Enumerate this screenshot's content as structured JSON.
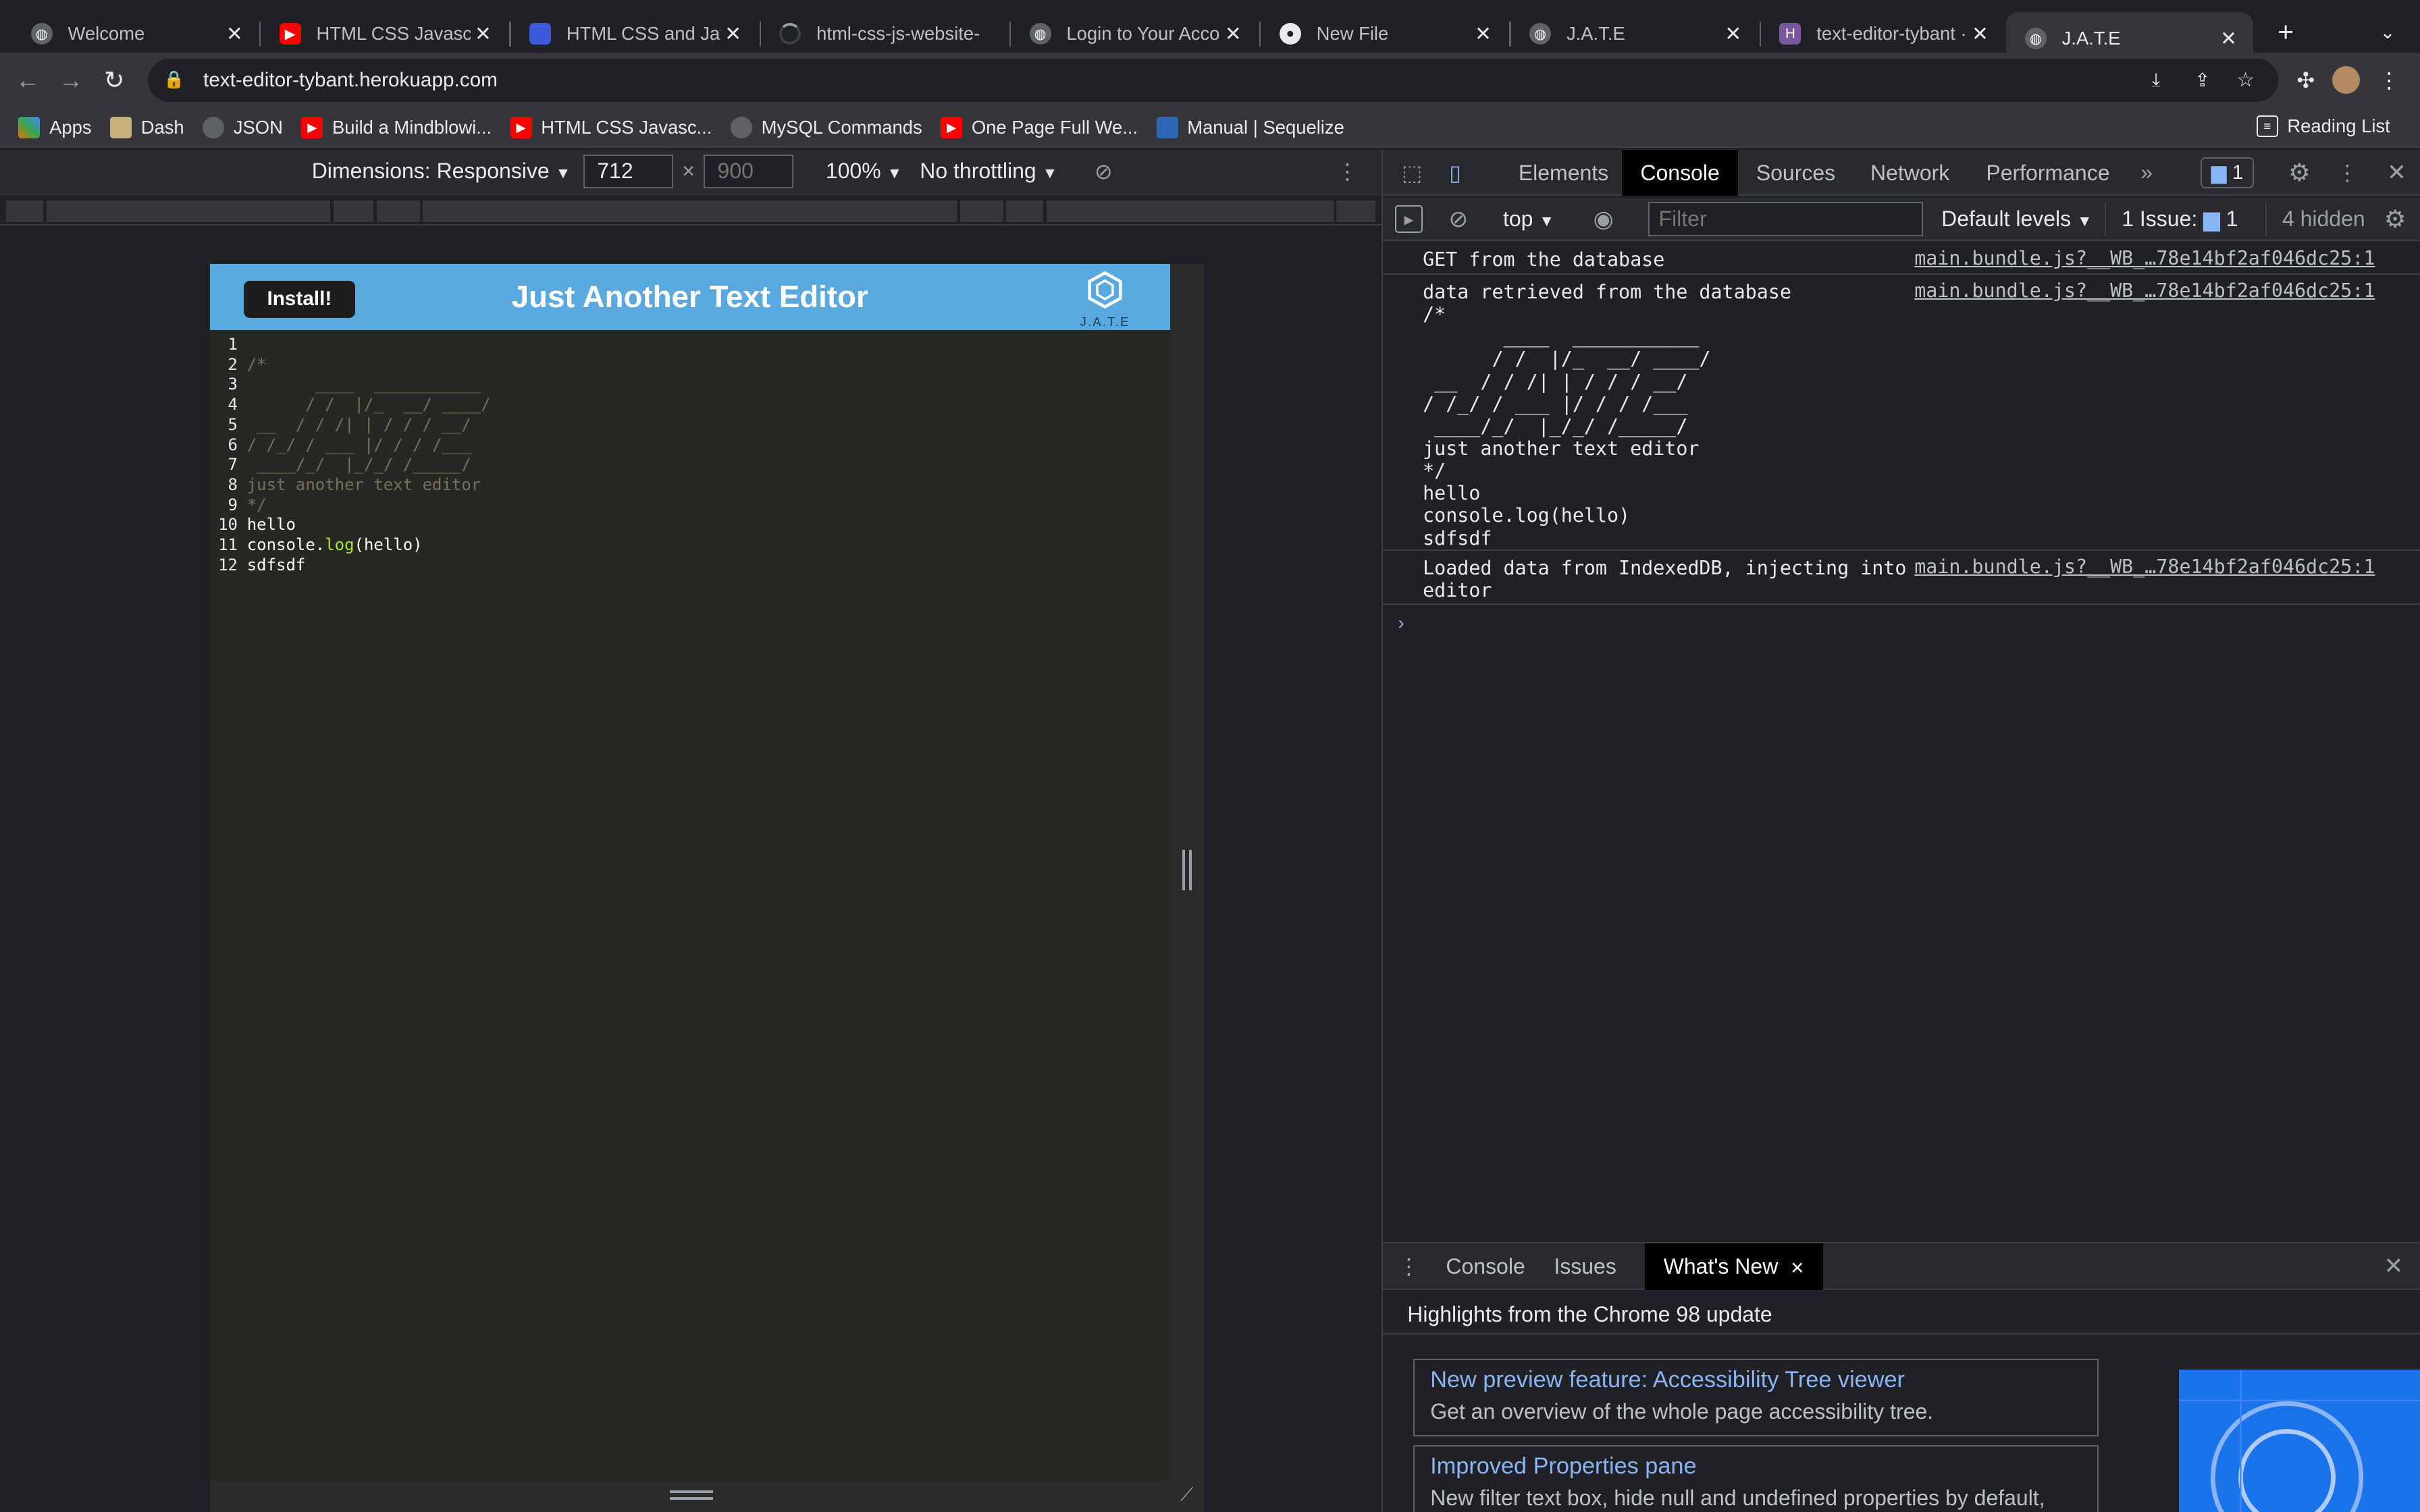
{
  "browser": {
    "tabs": [
      {
        "title": "Welcome",
        "icon": "globe-icon",
        "color": "#5f6368"
      },
      {
        "title": "HTML CSS Javascript",
        "icon": "youtube-icon",
        "color": "#ff0000"
      },
      {
        "title": "HTML CSS and Javas",
        "icon": "bag-icon",
        "color": "#3b5bdb"
      },
      {
        "title": "html-css-js-website-",
        "icon": "github-loading-icon",
        "color": "#5f6368"
      },
      {
        "title": "Login to Your Accoun",
        "icon": "globe-icon",
        "color": "#5f6368"
      },
      {
        "title": "New File",
        "icon": "github-icon",
        "color": "#e8eaed"
      },
      {
        "title": "J.A.T.E",
        "icon": "globe-icon",
        "color": "#5f6368"
      },
      {
        "title": "text-editor-tybant · C",
        "icon": "heroku-icon",
        "color": "#79589f"
      },
      {
        "title": "J.A.T.E",
        "icon": "globe-icon",
        "color": "#5f6368",
        "active": true
      }
    ],
    "url": "text-editor-tybant.herokuapp.com",
    "bookmarks": [
      {
        "label": "Apps",
        "icon": "apps-grid-icon",
        "color": "#e37400"
      },
      {
        "label": "Dash",
        "icon": "dash-icon",
        "color": "#c8b07a"
      },
      {
        "label": "JSON",
        "icon": "json-icon",
        "color": "#5f6368"
      },
      {
        "label": "Build a Mindblowi...",
        "icon": "youtube-icon",
        "color": "#ff0000"
      },
      {
        "label": "HTML CSS Javasc...",
        "icon": "youtube-icon",
        "color": "#ff0000"
      },
      {
        "label": "MySQL Commands",
        "icon": "globe-icon",
        "color": "#5f6368"
      },
      {
        "label": "One Page Full We...",
        "icon": "youtube-icon",
        "color": "#ff0000"
      },
      {
        "label": "Manual | Sequelize",
        "icon": "sequelize-icon",
        "color": "#2f67b6"
      }
    ],
    "reading_list": "Reading List"
  },
  "device_toolbar": {
    "dimensions": "Dimensions: Responsive",
    "width": "712",
    "height_placeholder": "900",
    "times": "×",
    "zoom": "100%",
    "throttling": "No throttling"
  },
  "app": {
    "install_label": "Install!",
    "title": "Just Another Text Editor",
    "logo_text": "J.A.T.E",
    "editor_lines": [
      {
        "n": "1",
        "text": ""
      },
      {
        "n": "2",
        "text": "/*",
        "cls": "cmt"
      },
      {
        "n": "3",
        "text": "       ____  ___________",
        "cls": "cmt"
      },
      {
        "n": "4",
        "text": "      / /  |/_  __/ ____/",
        "cls": "cmt"
      },
      {
        "n": "5",
        "text": " __  / / /| | / / / __/",
        "cls": "cmt"
      },
      {
        "n": "6",
        "text": "/ /_/ / ___ |/ / / /___",
        "cls": "cmt"
      },
      {
        "n": "7",
        "text": " ____/_/  |_/_/ /_____/",
        "cls": "cmt"
      },
      {
        "n": "8",
        "text": "just another text editor",
        "cls": "cmt"
      },
      {
        "n": "9",
        "text": "*/",
        "cls": "cmt"
      },
      {
        "n": "10",
        "text": "hello",
        "cls": "code"
      },
      {
        "n": "11",
        "text": "console.log(hello)",
        "cls": "code"
      },
      {
        "n": "12",
        "text": "sdfsdf",
        "cls": "code"
      }
    ]
  },
  "devtools": {
    "tabs": [
      "Elements",
      "Console",
      "Sources",
      "Network",
      "Performance"
    ],
    "active_tab": "Console",
    "issues_badge": "1",
    "console_bar": {
      "context": "top",
      "filter_placeholder": "Filter",
      "levels": "Default levels",
      "issues": "1 Issue:",
      "issues_count": "1",
      "hidden": "4 hidden"
    },
    "messages": [
      {
        "text": "GET from the database",
        "source": "main.bundle.js?__WB_…78e14bf2af046dc25:1"
      },
      {
        "text": "data retrieved from the database\n/*\n       ____  ___________\n      / /  |/_  __/ ____/\n __  / / /| | / / / __/\n/ /_/ / ___ |/ / / /___\n ____/_/  |_/_/ /_____/\njust another text editor\n*/\nhello\nconsole.log(hello)\nsdfsdf",
        "source": "main.bundle.js?__WB_…78e14bf2af046dc25:1"
      },
      {
        "text": "Loaded data from IndexedDB, injecting into\neditor",
        "source": "main.bundle.js?__WB_…78e14bf2af046dc25:1"
      }
    ],
    "drawer": {
      "tabs": [
        "Console",
        "Issues",
        "What's New"
      ],
      "active": "What's New",
      "heading": "Highlights from the Chrome 98 update",
      "cards": [
        {
          "title": "New preview feature: Accessibility Tree viewer",
          "desc": "Get an overview of the whole page accessibility tree."
        },
        {
          "title": "Improved Properties pane",
          "desc": "New filter text box, hide null and undefined properties by default,"
        }
      ]
    }
  }
}
